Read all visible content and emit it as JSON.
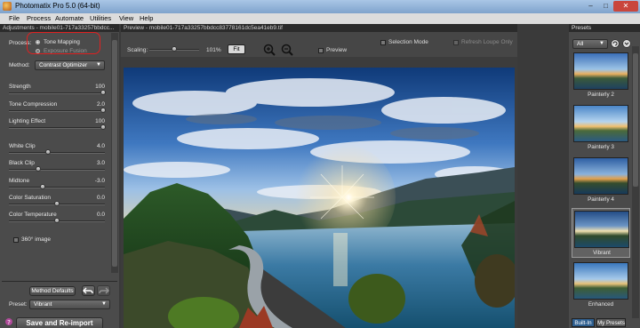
{
  "window": {
    "title": "Photomatix Pro 5.0 (64-bit)",
    "min": "–",
    "max": "□",
    "close": "✕"
  },
  "menu": [
    "File",
    "Process",
    "Automate",
    "Utilities",
    "View",
    "Help"
  ],
  "adjustments": {
    "panel_title": "Adjustments - mobile01-717a33257bbdcc...",
    "process_label": "Process:",
    "process_options": [
      "Tone Mapping",
      "Exposure Fusion"
    ],
    "process_selected": "Tone Mapping",
    "method_label": "Method:",
    "method_value": "Contrast Optimizer",
    "sliders": [
      {
        "label": "Strength",
        "value": "100",
        "pos": 1.0
      },
      {
        "label": "Tone Compression",
        "value": "2.0",
        "pos": 1.0
      },
      {
        "label": "Lighting Effect",
        "value": "100",
        "pos": 1.0
      },
      {
        "label": "White Clip",
        "value": "4.0",
        "pos": 0.4
      },
      {
        "label": "Black Clip",
        "value": "3.0",
        "pos": 0.3
      },
      {
        "label": "Midtone",
        "value": "-3.0",
        "pos": 0.35
      },
      {
        "label": "Color Saturation",
        "value": "0.0",
        "pos": 0.5
      },
      {
        "label": "Color Temperature",
        "value": "0.0",
        "pos": 0.5
      }
    ],
    "checkbox_360": "360° image",
    "method_defaults": "Method Defaults",
    "preset_label": "Preset:",
    "preset_value": "Vibrant",
    "save_reimport": "Save and Re-import"
  },
  "preview": {
    "panel_title": "Preview - mobile01-717a33257bbdcc83778161dc5ea41eb9.tif",
    "scaling_label": "Scaling:",
    "scaling_value": "101%",
    "fit": "Fit",
    "preview_label": "Preview",
    "selection_mode": "Selection Mode",
    "refresh_label": "Refresh Loupe Only"
  },
  "presets": {
    "panel_title": "Presets",
    "filter": "All",
    "items": [
      "Painterly 2",
      "Painterly 3",
      "Painterly 4",
      "Vibrant",
      "Enhanced"
    ],
    "selected": "Vibrant",
    "tabs": [
      "Built-In",
      "My Presets"
    ]
  },
  "colors": {
    "accent": "#e02020",
    "panel": "#4b4b4b",
    "dark": "#2b2b2b"
  }
}
